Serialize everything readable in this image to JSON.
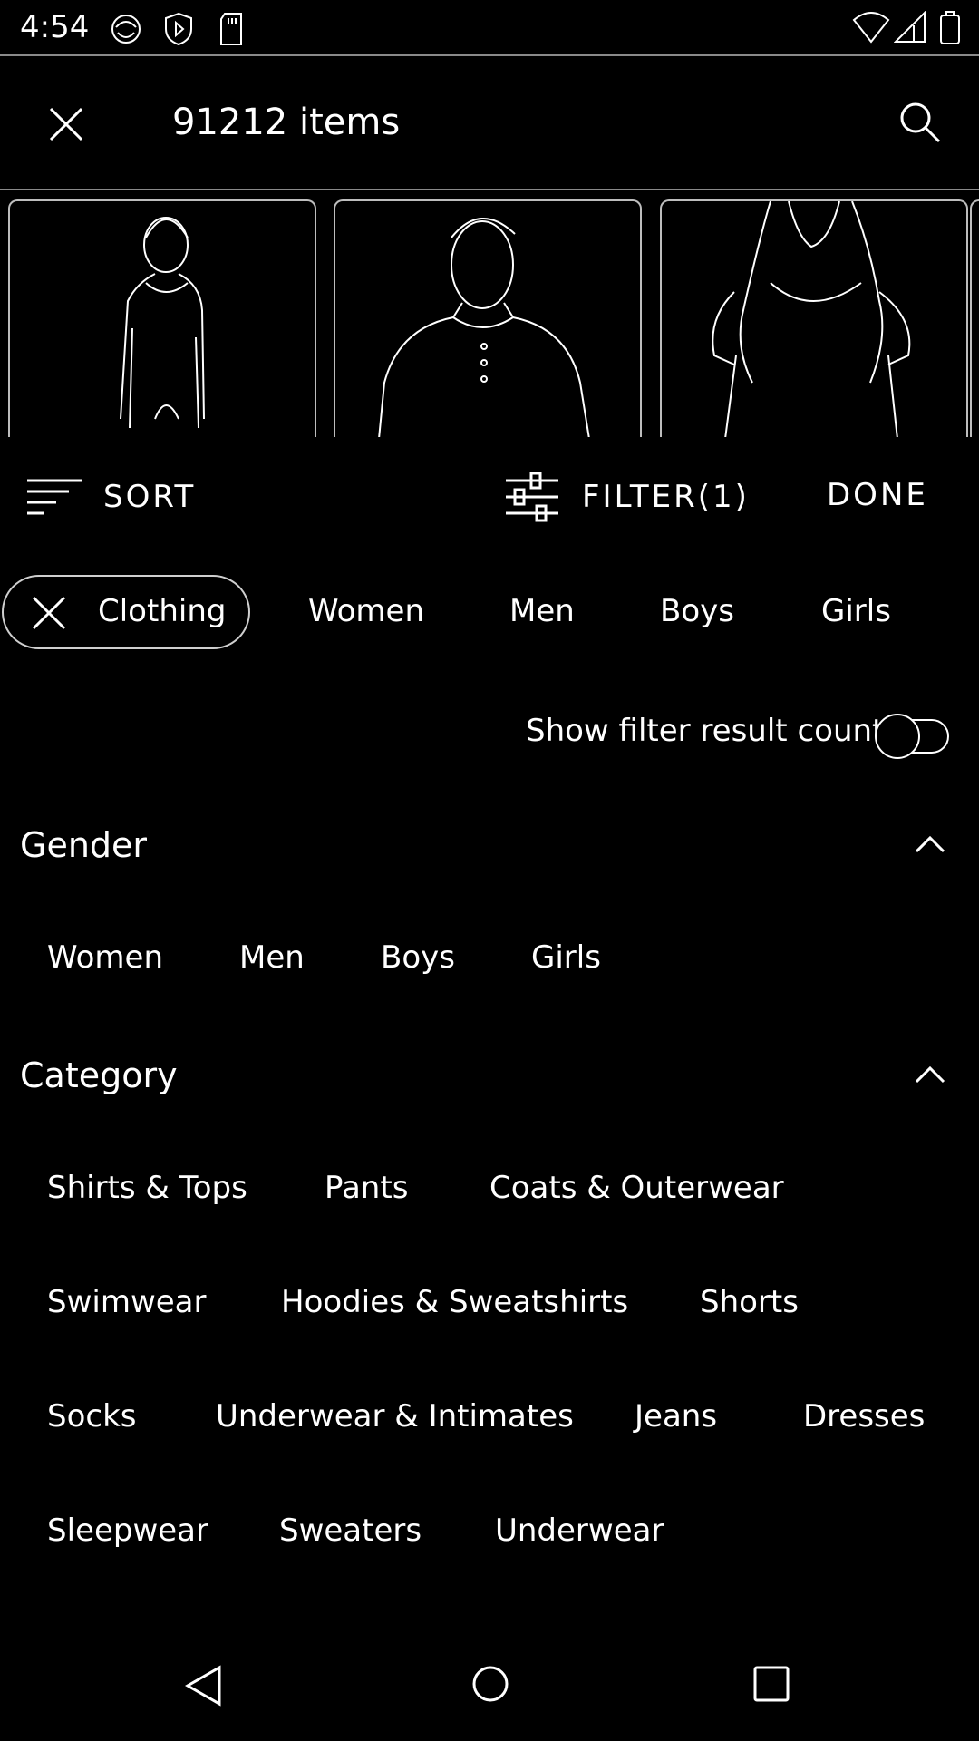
{
  "status_bar": {
    "time": "4:54",
    "icons": [
      "sync-icon",
      "shield-icon",
      "sd-card-icon",
      "wifi-icon",
      "signal-icon",
      "battery-icon"
    ]
  },
  "header": {
    "title": "91212 items",
    "close_icon": "close-icon",
    "search_icon": "search-icon"
  },
  "product_strip": {
    "cards": [
      "woman-in-long-sleeve-top",
      "man-in-henley-shirt",
      "woman-in-tee"
    ]
  },
  "toolbar": {
    "sort_label": "SORT",
    "filter_label": "FILTER(1)",
    "done_label": "DONE"
  },
  "chips": {
    "active": "Clothing",
    "items": [
      "Women",
      "Men",
      "Boys",
      "Girls"
    ]
  },
  "toggle": {
    "label": "Show filter result count",
    "state": "off"
  },
  "gender": {
    "title": "Gender",
    "options": [
      "Women",
      "Men",
      "Boys",
      "Girls"
    ]
  },
  "category": {
    "title": "Category",
    "rows": [
      [
        "Shirts & Tops",
        "Pants",
        "Coats & Outerwear"
      ],
      [
        "Swimwear",
        "Hoodies & Sweatshirts",
        "Shorts"
      ],
      [
        "Socks",
        "Underwear & Intimates",
        "Jeans",
        "Dresses"
      ],
      [
        "Sleepwear",
        "Sweaters",
        "Underwear"
      ]
    ]
  },
  "nav_bar": {
    "icons": [
      "back-icon",
      "home-icon",
      "recents-icon"
    ]
  }
}
